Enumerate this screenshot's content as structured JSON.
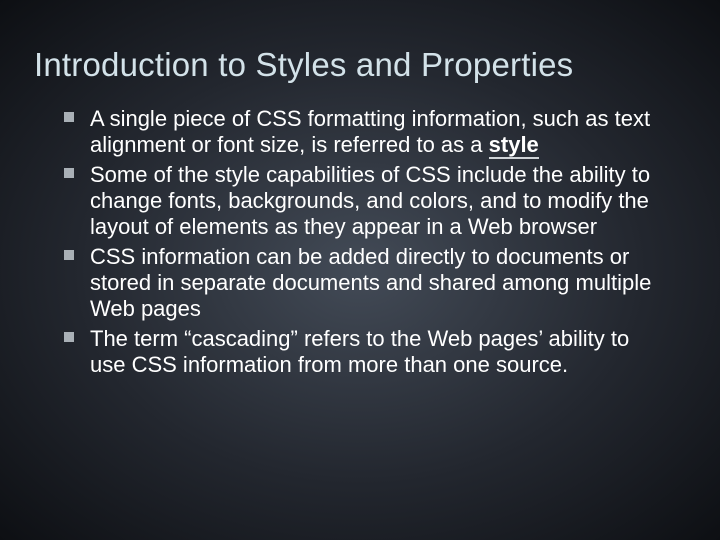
{
  "title": "Introduction to Styles and Properties",
  "bullets": [
    {
      "pre": "A single piece of CSS formatting information, such as text alignment or font size, is referred to as a ",
      "term": "style",
      "post": ""
    },
    {
      "pre": "Some of the style capabilities of CSS include the ability to change fonts, backgrounds, and colors, and to modify the layout of elements as they appear in a Web browser",
      "term": "",
      "post": ""
    },
    {
      "pre": "CSS information can be added directly to documents or stored in separate documents and shared among multiple Web pages",
      "term": "",
      "post": ""
    },
    {
      "pre": "The term “cascading” refers to the Web pages’ ability to use CSS information from more than one source.",
      "term": "",
      "post": ""
    }
  ]
}
